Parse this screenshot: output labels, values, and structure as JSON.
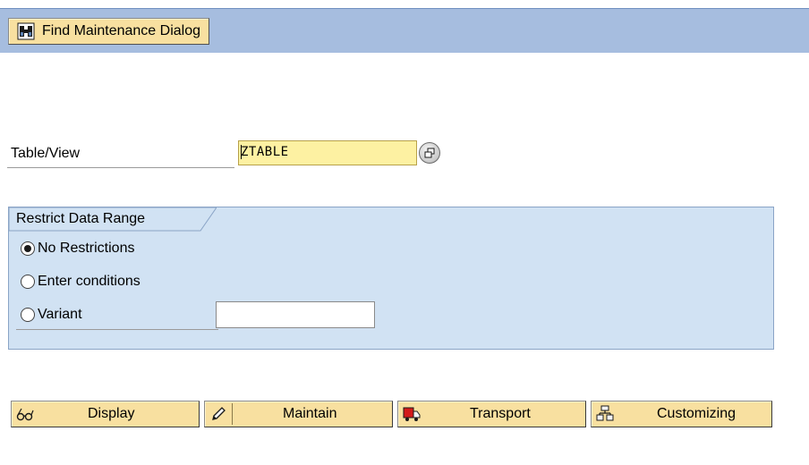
{
  "toolbar": {
    "find_button_label": "Find Maintenance Dialog",
    "find_icon": "binoculars-icon"
  },
  "selection": {
    "table_view_label": "Table/View",
    "table_view_value": "ZTABLE",
    "value_help_icon": "value-help-icon"
  },
  "restrict_group": {
    "title": "Restrict Data Range",
    "options": [
      {
        "label": "No Restrictions",
        "selected": true
      },
      {
        "label": "Enter conditions",
        "selected": false
      },
      {
        "label": "Variant",
        "selected": false
      }
    ],
    "variant_value": ""
  },
  "actions": {
    "display": {
      "label": "Display",
      "icon": "glasses-icon"
    },
    "maintain": {
      "label": "Maintain",
      "icon": "pencil-icon"
    },
    "transport": {
      "label": "Transport",
      "icon": "truck-icon"
    },
    "customizing": {
      "label": "Customizing",
      "icon": "hierarchy-icon"
    }
  },
  "colors": {
    "toolbar_bg": "#a6bddf",
    "button_bg": "#f8e0a0",
    "input_required_bg": "#fdf1a2",
    "group_bg": "#d1e2f3"
  }
}
